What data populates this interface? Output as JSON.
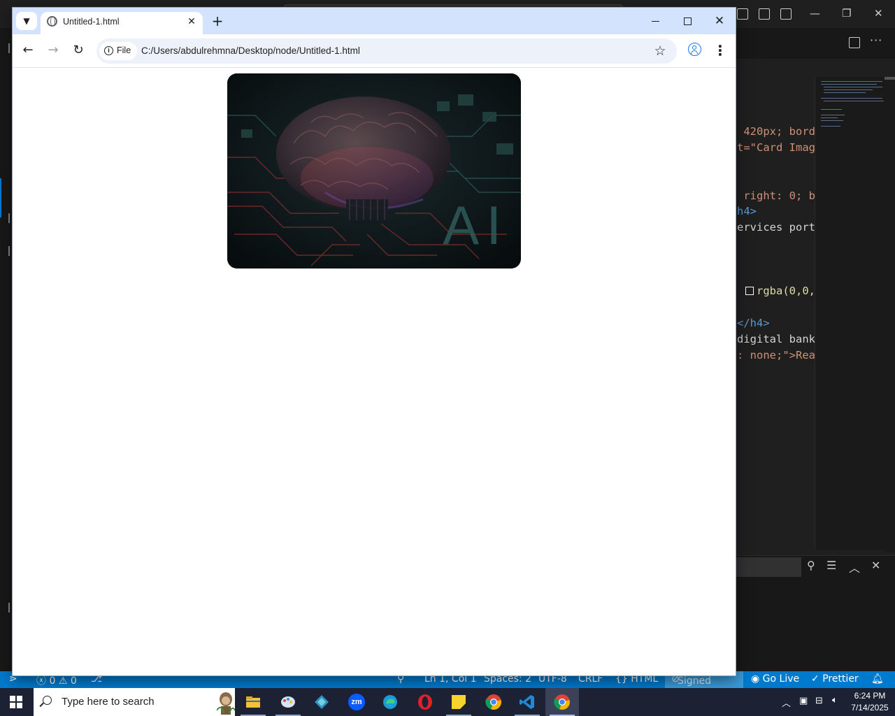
{
  "vscode": {
    "code_lines": [
      {
        "text": " 420px; bord",
        "style": "num"
      },
      {
        "text": "t=\"Card Imag",
        "style": "str"
      },
      {
        "text": " right: 0; b",
        "style": "num"
      },
      {
        "text": "h4>",
        "style": "tag"
      },
      {
        "text": "ervices port",
        "style": "plain"
      },
      {
        "text": "rgba(0,0,",
        "style": "fn"
      },
      {
        "text": "</h4>",
        "style": "tag"
      },
      {
        "text": "digital bank",
        "style": "plain"
      },
      {
        "text": ": none;\">Rea",
        "style": "str"
      }
    ],
    "status": {
      "errors": "0",
      "warnings": "0",
      "position": "Ln 1, Col 1",
      "spaces": "Spaces: 2",
      "encoding": "UTF-8",
      "eol": "CRLF",
      "language": "HTML",
      "account": "Signed out",
      "go_live": "Go Live",
      "prettier": "Prettier"
    }
  },
  "chrome": {
    "tab_title": "Untitled-1.html",
    "chip_label": "File",
    "url": "C:/Users/abdulrehmna/Desktop/node/Untitled-1.html"
  },
  "page": {
    "card_image_text": "AI"
  },
  "taskbar": {
    "search_placeholder": "Type here to search",
    "apps": [
      "file-explorer",
      "paint",
      "app-3",
      "zoom",
      "edge",
      "opera",
      "sticky-notes",
      "chrome",
      "vscode",
      "chrome-active"
    ],
    "zoom_label": "zm",
    "time": "6:24 PM",
    "date": "7/14/2025"
  },
  "colors": {
    "vscode_status": "#007acc",
    "chrome_tabbar": "#d3e3fd",
    "taskbar": "#1c2233"
  }
}
